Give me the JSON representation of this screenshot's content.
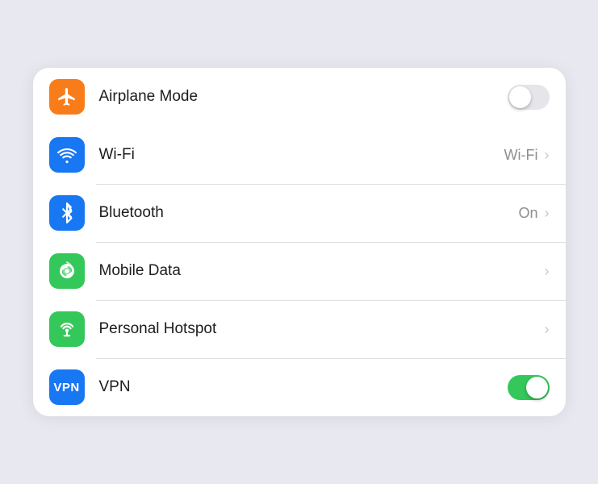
{
  "rows": [
    {
      "id": "airplane-mode",
      "label": "Airplane Mode",
      "icon_type": "airplane",
      "icon_color": "orange",
      "right_type": "toggle",
      "toggle_on": false,
      "right_label": "",
      "show_chevron": false,
      "no_divider": true
    },
    {
      "id": "wifi",
      "label": "Wi-Fi",
      "icon_type": "wifi",
      "icon_color": "blue",
      "right_type": "label-chevron",
      "toggle_on": false,
      "right_label": "Wi-Fi",
      "show_chevron": true,
      "no_divider": false
    },
    {
      "id": "bluetooth",
      "label": "Bluetooth",
      "icon_type": "bluetooth",
      "icon_color": "blue-bt",
      "right_type": "label-chevron",
      "toggle_on": false,
      "right_label": "On",
      "show_chevron": true,
      "no_divider": false
    },
    {
      "id": "mobile-data",
      "label": "Mobile Data",
      "icon_type": "mobile-data",
      "icon_color": "green",
      "right_type": "chevron",
      "toggle_on": false,
      "right_label": "",
      "show_chevron": true,
      "no_divider": false
    },
    {
      "id": "personal-hotspot",
      "label": "Personal Hotspot",
      "icon_type": "hotspot",
      "icon_color": "green2",
      "right_type": "chevron",
      "toggle_on": false,
      "right_label": "",
      "show_chevron": true,
      "no_divider": false
    },
    {
      "id": "vpn",
      "label": "VPN",
      "icon_type": "vpn",
      "icon_color": "blue-vpn",
      "right_type": "toggle",
      "toggle_on": true,
      "right_label": "",
      "show_chevron": false,
      "no_divider": true
    }
  ],
  "chevron_char": "›",
  "vpn_text": "VPN"
}
